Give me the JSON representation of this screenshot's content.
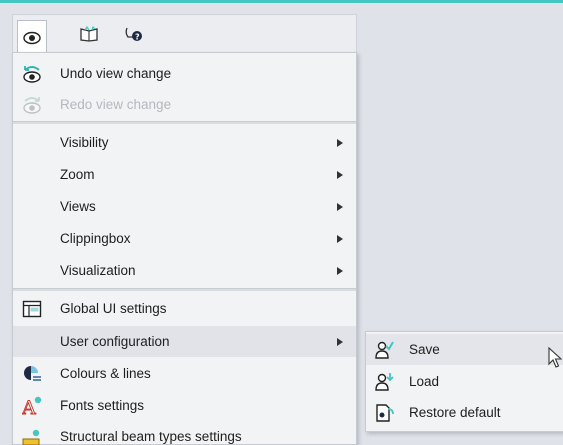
{
  "toolbar": {
    "icons": [
      "eye-icon",
      "book-icon",
      "help-icon"
    ]
  },
  "menu": {
    "undo_label": "Undo view change",
    "redo_label": "Redo view change",
    "visibility_label": "Visibility",
    "zoom_label": "Zoom",
    "views_label": "Views",
    "clippingbox_label": "Clippingbox",
    "visualization_label": "Visualization",
    "global_ui_label": "Global UI settings",
    "user_config_label": "User configuration",
    "colours_label": "Colours & lines",
    "fonts_label": "Fonts settings",
    "beam_types_label": "Structural beam types settings"
  },
  "submenu": {
    "save_label": "Save",
    "load_label": "Load",
    "restore_label": "Restore default"
  },
  "colors": {
    "accent_strip": "#43c7c0",
    "menu_bg": "#f2f3f5",
    "highlight": "#e1e3e8",
    "disabled_text": "#b4b8bf"
  }
}
